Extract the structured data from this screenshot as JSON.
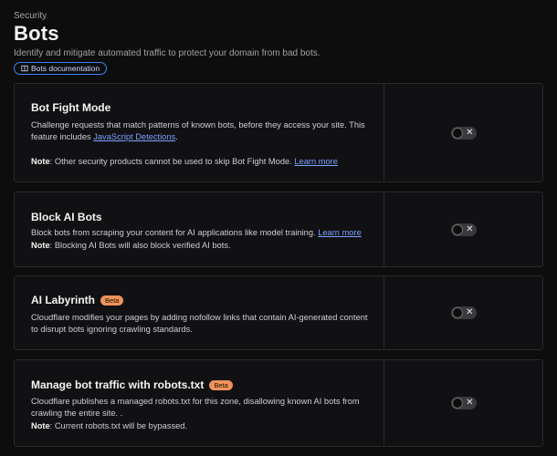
{
  "header": {
    "eyebrow": "Security",
    "title": "Bots",
    "description": "Identify and mitigate automated traffic to protect your domain from bad bots.",
    "docs_button": "Bots documentation"
  },
  "cards": [
    {
      "title": "Bot Fight Mode",
      "text_1": "Challenge requests that match patterns of known bots, before they access your site. This feature includes",
      "link_1": "JavaScript Detections",
      "text_1_end": ".",
      "note_label": "Note",
      "note_text": ": Other security products cannot be used to skip Bot Fight Mode.",
      "note_link": "Learn more",
      "enabled": false
    },
    {
      "title": "Block AI Bots",
      "text_1": "Block bots from scraping your content for AI applications like model training.",
      "link_1": "Learn more",
      "note_label": "Note",
      "note_text": ": Blocking AI Bots will also block verified AI bots.",
      "enabled": false
    },
    {
      "title": "AI Labyrinth",
      "badge": "Beta",
      "text_1": "Cloudflare modifies your pages by adding nofollow links that contain AI-generated content to disrupt bots ignoring crawling standards.",
      "enabled": false
    },
    {
      "title": "Manage bot traffic with robots.txt",
      "badge": "Beta",
      "text_1": "Cloudflare publishes a managed robots.txt for this zone, disallowing known AI bots from crawling the entire site. .",
      "note_label": "Note",
      "note_text": ": Current robots.txt will be bypassed.",
      "enabled": false
    }
  ],
  "toggle_off_glyph": "✕",
  "colors": {
    "accent_link": "#7aa2ff",
    "badge": "#f0935a",
    "docs_border": "#3b82f6"
  }
}
